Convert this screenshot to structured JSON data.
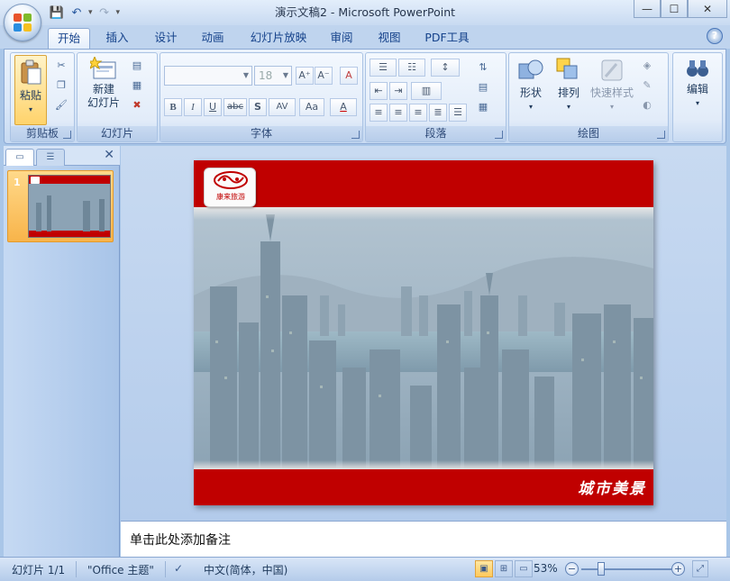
{
  "window": {
    "title": "演示文稿2 - Microsoft PowerPoint",
    "controls": {
      "minimize": "—",
      "maximize": "☐",
      "close": "✕"
    }
  },
  "qat": {
    "save": "💾",
    "undo": "↶",
    "redo": "↷",
    "more": "▾"
  },
  "tabs": [
    {
      "label": "开始",
      "active": true
    },
    {
      "label": "插入"
    },
    {
      "label": "设计"
    },
    {
      "label": "动画"
    },
    {
      "label": "幻灯片放映"
    },
    {
      "label": "审阅"
    },
    {
      "label": "视图"
    },
    {
      "label": "PDF工具"
    }
  ],
  "help": "?",
  "ribbon": {
    "clipboard": {
      "label": "剪贴板",
      "paste": "粘贴"
    },
    "slides": {
      "label": "幻灯片",
      "new_slide_line1": "新建",
      "new_slide_line2": "幻灯片"
    },
    "font": {
      "label": "字体",
      "font_name": "",
      "font_size": "18",
      "grow": "A⁺",
      "shrink": "A⁻",
      "clear": "A",
      "bold": "B",
      "italic": "I",
      "underline": "U",
      "strike": "abc",
      "shadow": "S",
      "spacing": "AV",
      "case": "Aa",
      "color": "A"
    },
    "paragraph": {
      "label": "段落"
    },
    "drawing": {
      "label": "绘图",
      "shapes": "形状",
      "arrange": "排列",
      "quick_styles": "快速样式"
    },
    "editing": {
      "label": "编辑"
    }
  },
  "left_pane": {
    "slide_number": "1",
    "close": "✕"
  },
  "slide": {
    "logo_text": "康来旅游",
    "caption": "城市美景"
  },
  "notes": {
    "placeholder": "单击此处添加备注"
  },
  "status": {
    "slide": "幻灯片 1/1",
    "theme": "\"Office 主题\"",
    "language": "中文(简体，中国)",
    "zoom": "53%",
    "zoom_out": "−",
    "zoom_in": "+"
  },
  "colors": {
    "slide_red": "#c00000",
    "ribbon_blue": "#dbe8f8",
    "selected_thumb": "#f8b44a"
  }
}
